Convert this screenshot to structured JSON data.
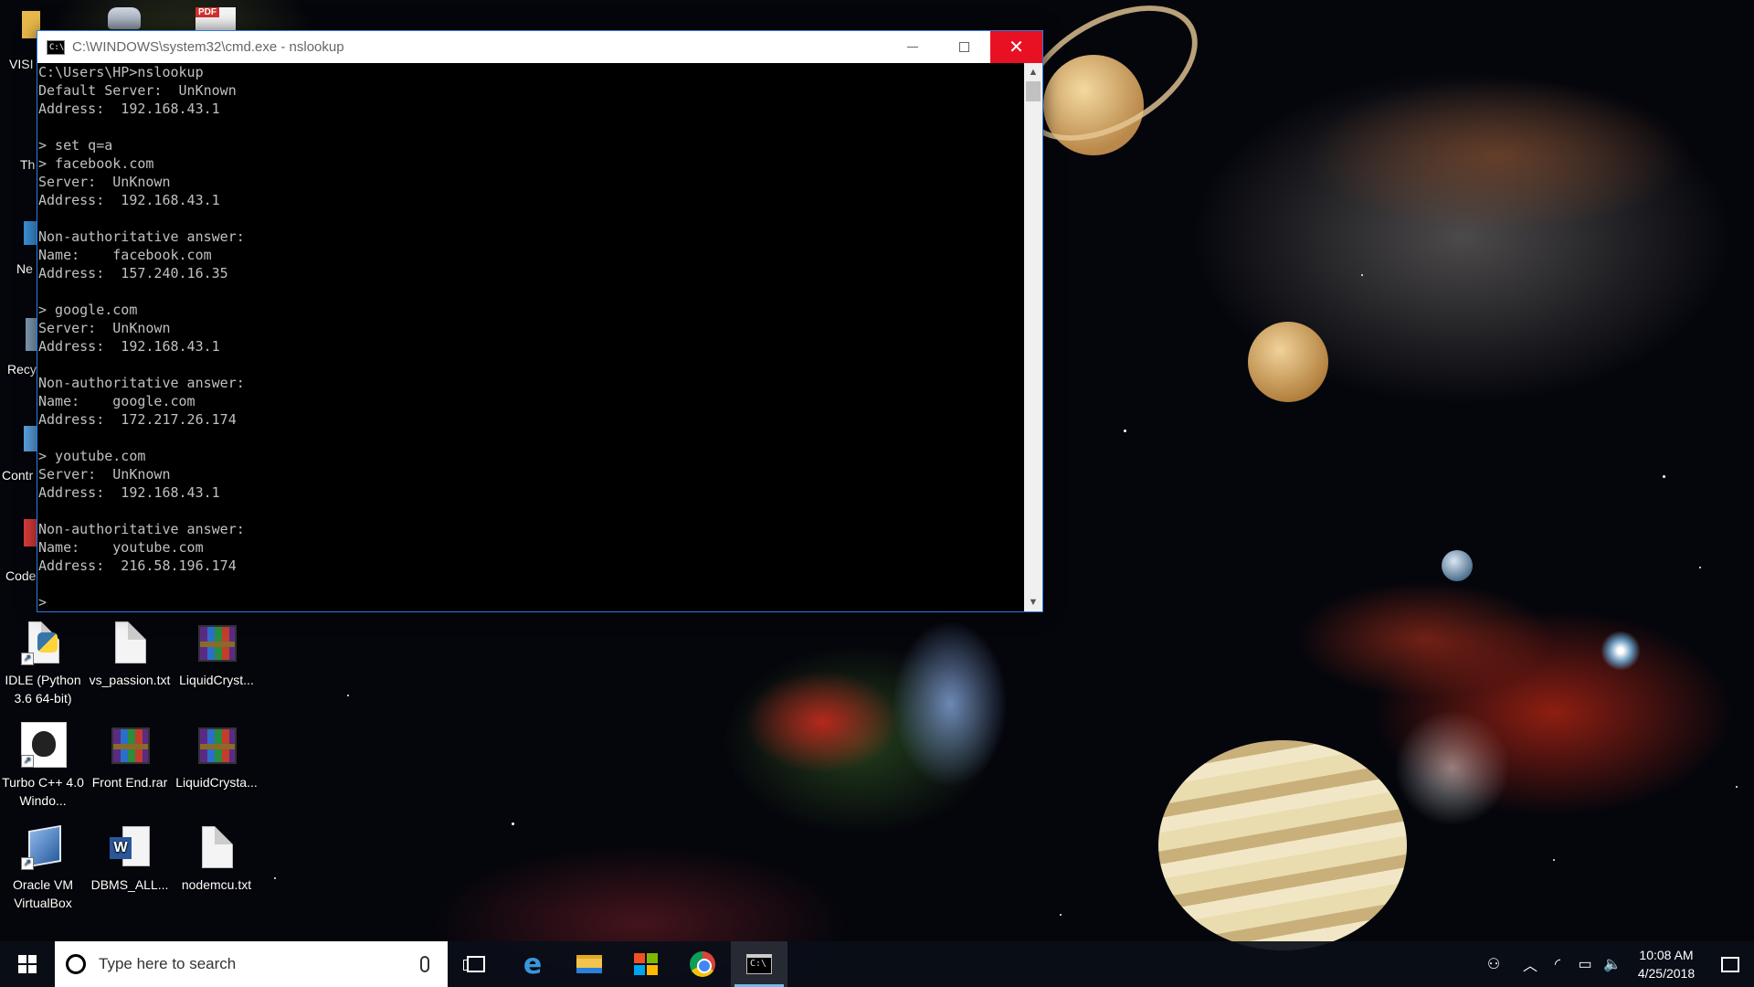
{
  "cmd_window": {
    "title": "C:\\WINDOWS\\system32\\cmd.exe - nslookup",
    "title_icon": "C:\\",
    "minimize_icon": "minimize-icon",
    "maximize_icon": "maximize-icon",
    "close_glyph": "✕",
    "console_lines": [
      "C:\\Users\\HP>nslookup",
      "Default Server:  UnKnown",
      "Address:  192.168.43.1",
      "",
      "> set q=a",
      "> facebook.com",
      "Server:  UnKnown",
      "Address:  192.168.43.1",
      "",
      "Non-authoritative answer:",
      "Name:    facebook.com",
      "Address:  157.240.16.35",
      "",
      "> google.com",
      "Server:  UnKnown",
      "Address:  192.168.43.1",
      "",
      "Non-authoritative answer:",
      "Name:    google.com",
      "Address:  172.217.26.174",
      "",
      "> youtube.com",
      "Server:  UnKnown",
      "Address:  192.168.43.1",
      "",
      "Non-authoritative answer:",
      "Name:    youtube.com",
      "Address:  216.58.196.174",
      "",
      ">"
    ],
    "scroll_up": "▲",
    "scroll_down": "▼"
  },
  "desktop": {
    "partial_labels": [
      "VISI",
      "Th",
      "Ne",
      "Recy",
      "Contr",
      "Code"
    ],
    "pdf_badge": "PDF",
    "icons": [
      {
        "label": "IDLE (Python 3.6 64-bit)",
        "icon": "python-icon"
      },
      {
        "label": "vs_passion.txt",
        "icon": "text-file-icon"
      },
      {
        "label": "LiquidCryst...",
        "icon": "winrar-icon"
      },
      {
        "label": "Turbo C++ 4.0 Windo...",
        "icon": "apple-logo-icon"
      },
      {
        "label": "Front End.rar",
        "icon": "winrar-icon"
      },
      {
        "label": "LiquidCrysta...",
        "icon": "winrar-icon"
      },
      {
        "label": "Oracle VM VirtualBox",
        "icon": "virtualbox-icon"
      },
      {
        "label": "DBMS_ALL...",
        "icon": "word-document-icon"
      },
      {
        "label": "nodemcu.txt",
        "icon": "text-file-icon"
      }
    ]
  },
  "taskbar": {
    "search_placeholder": "Type here to search",
    "edge_glyph": "e",
    "cmd_glyph": "C:\\",
    "tray": {
      "people_glyph": "⚇",
      "chevron_glyph": "︿",
      "wifi_glyph": "◜",
      "battery_glyph": "▭",
      "volume_glyph": "🔈",
      "time": "10:08 AM",
      "date": "4/25/2018"
    }
  },
  "colors": {
    "close_button": "#e81123",
    "console_bg": "#000000",
    "console_text": "#c0c0c0",
    "taskbar_active_indicator": "#76b9ed"
  }
}
